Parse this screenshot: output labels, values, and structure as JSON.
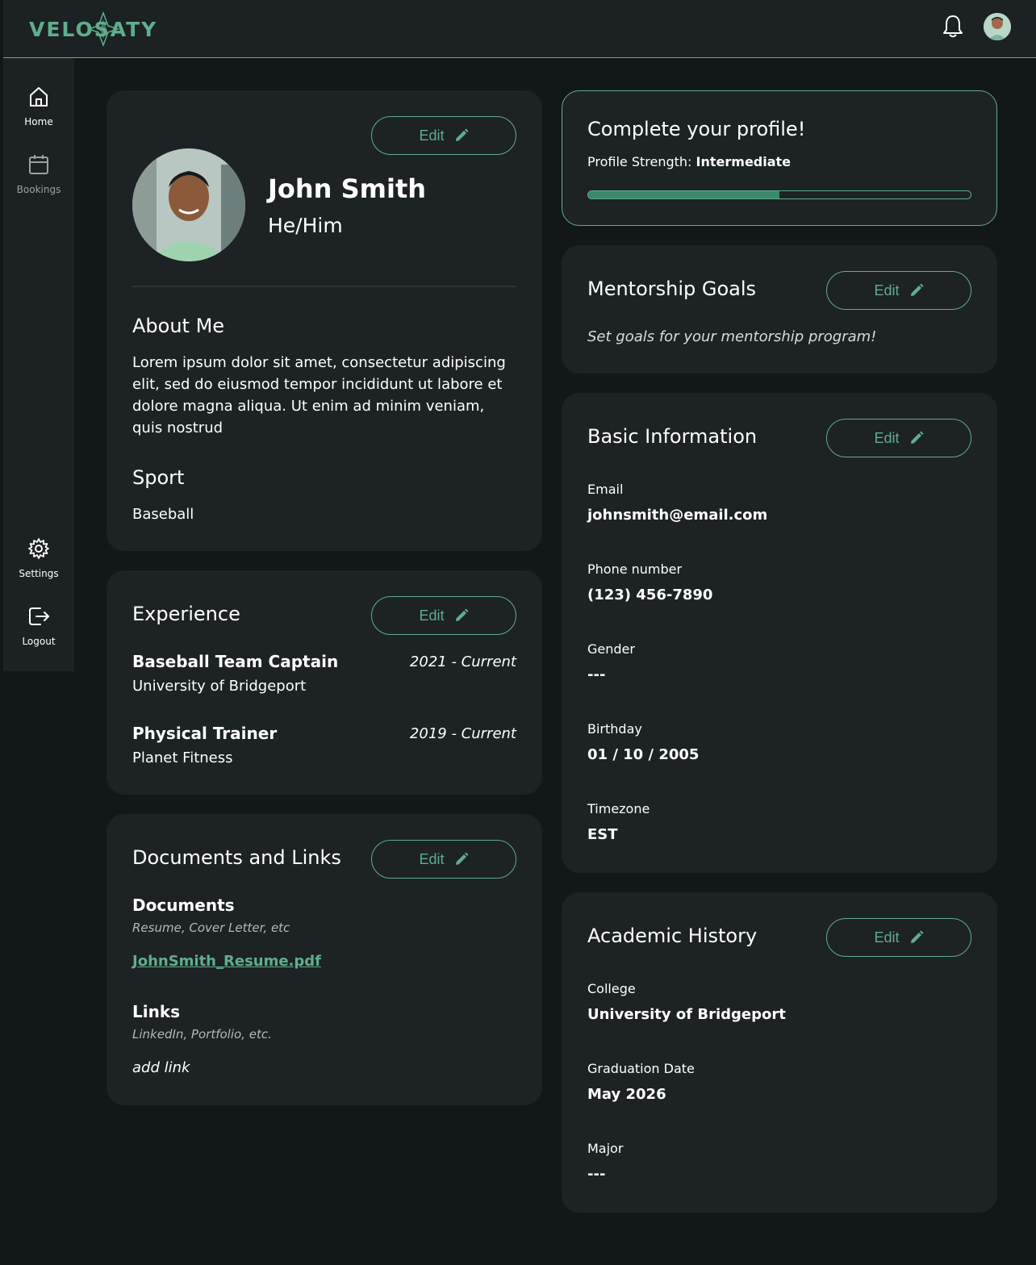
{
  "brand": {
    "name": "VELOSATY",
    "accent": "#5fae8e"
  },
  "header": {
    "notification_icon": "bell-icon",
    "avatar_label": ""
  },
  "sidebar": {
    "items": [
      {
        "label": "Home",
        "icon": "home-icon",
        "active": true
      },
      {
        "label": "Bookings",
        "icon": "calendar-icon",
        "active": false
      },
      {
        "label": "Settings",
        "icon": "gear-icon",
        "active": false
      },
      {
        "label": "Logout",
        "icon": "logout-icon",
        "active": false
      }
    ]
  },
  "profile": {
    "edit_label": "Edit",
    "name": "John Smith",
    "pronouns": "He/Him",
    "about_heading": "About Me",
    "about_text": "Lorem ipsum dolor sit amet, consectetur adipiscing elit, sed do eiusmod tempor incididunt ut labore et dolore magna aliqua. Ut enim ad minim veniam, quis nostrud",
    "sport_heading": "Sport",
    "sport_value": "Baseball"
  },
  "experience": {
    "heading": "Experience",
    "edit_label": "Edit",
    "items": [
      {
        "title": "Baseball Team Captain",
        "org": "University of Bridgeport",
        "dates": "2021 - Current"
      },
      {
        "title": "Physical Trainer",
        "org": "Planet Fitness",
        "dates": "2019 - Current"
      }
    ]
  },
  "documents": {
    "heading": "Documents and Links",
    "edit_label": "Edit",
    "docs_heading": "Documents",
    "docs_hint": "Resume, Cover Letter, etc",
    "doc_file": "JohnSmith_Resume.pdf",
    "links_heading": "Links",
    "links_hint": "LinkedIn, Portfolio, etc.",
    "add_link": "add link"
  },
  "completion": {
    "heading": "Complete your profile!",
    "strength_label": "Profile Strength:",
    "strength_value": "Intermediate",
    "progress": 0.5
  },
  "mentorship": {
    "heading": "Mentorship Goals",
    "edit_label": "Edit",
    "placeholder": "Set goals for your mentorship program!"
  },
  "basic_info": {
    "heading": "Basic Information",
    "edit_label": "Edit",
    "fields": [
      {
        "label": "Email",
        "value": "johnsmith@email.com"
      },
      {
        "label": "Phone number",
        "value": "(123) 456-7890"
      },
      {
        "label": "Gender",
        "value": "---"
      },
      {
        "label": "Birthday",
        "value": "01 / 10 / 2005"
      },
      {
        "label": "Timezone",
        "value": "EST"
      }
    ]
  },
  "academic": {
    "heading": "Academic History",
    "edit_label": "Edit",
    "fields": [
      {
        "label": "College",
        "value": "University of Bridgeport"
      },
      {
        "label": "Graduation Date",
        "value": "May 2026"
      },
      {
        "label": "Major",
        "value": "---"
      }
    ]
  }
}
